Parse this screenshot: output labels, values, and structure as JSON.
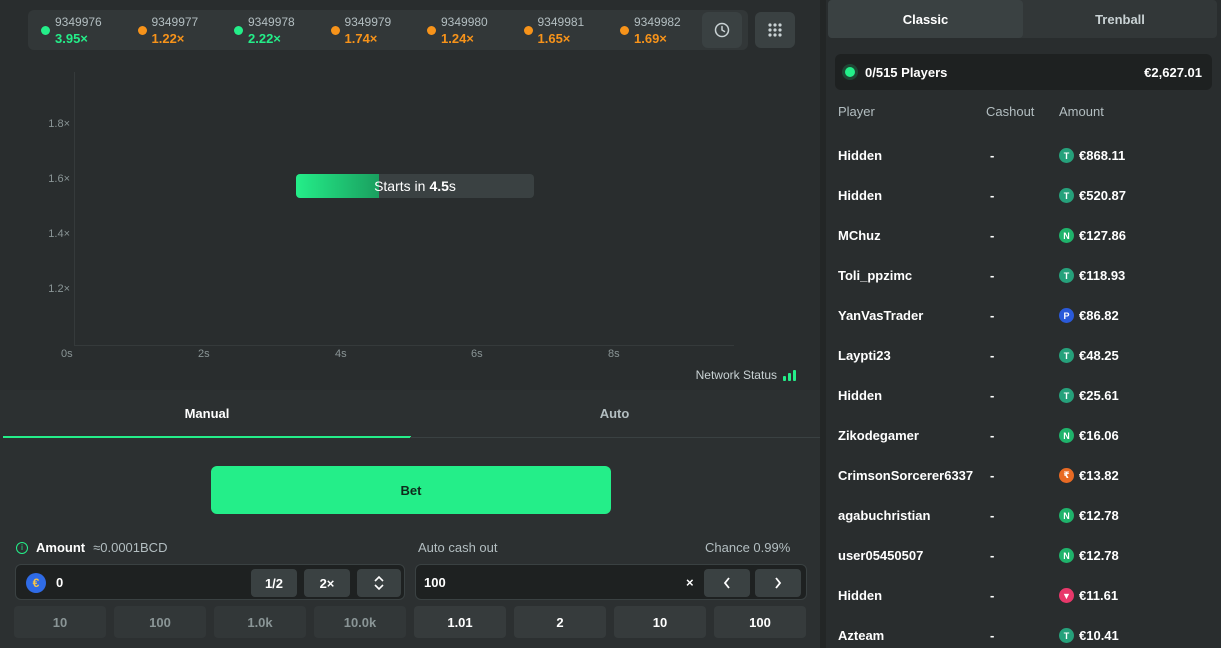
{
  "history": [
    {
      "id": "9349976",
      "mult": "3.95×",
      "color": "#24ee89"
    },
    {
      "id": "9349977",
      "mult": "1.22×",
      "color": "#f7931a"
    },
    {
      "id": "9349978",
      "mult": "2.22×",
      "color": "#24ee89"
    },
    {
      "id": "9349979",
      "mult": "1.74×",
      "color": "#f7931a"
    },
    {
      "id": "9349980",
      "mult": "1.24×",
      "color": "#f7931a"
    },
    {
      "id": "9349981",
      "mult": "1.65×",
      "color": "#f7931a"
    },
    {
      "id": "9349982",
      "mult": "1.69×",
      "color": "#f7931a"
    }
  ],
  "chart": {
    "y_ticks": [
      "1.8×",
      "1.6×",
      "1.4×",
      "1.2×"
    ],
    "x_ticks": [
      "0s",
      "2s",
      "4s",
      "6s",
      "8s"
    ],
    "countdown_prefix": "Starts in",
    "countdown_value": "4.5",
    "countdown_unit": "s",
    "countdown_progress": 0.35,
    "network_label": "Network Status"
  },
  "controls": {
    "tab_manual": "Manual",
    "tab_auto": "Auto",
    "bet_label": "Bet",
    "amount_label": "Amount",
    "amount_approx": "≈0.0001BCD",
    "amount_value": "0",
    "half_label": "1/2",
    "double_label": "2×",
    "auto_cashout_label": "Auto cash out",
    "chance_label": "Chance 0.99%",
    "auto_cashout_value": "100",
    "times_symbol": "×",
    "amount_quick": [
      "10",
      "100",
      "1.0k",
      "10.0k"
    ],
    "cashout_quick": [
      "1.01",
      "2",
      "10",
      "100"
    ]
  },
  "right": {
    "tab_classic": "Classic",
    "tab_trenball": "Trenball",
    "players_count": "0/515 Players",
    "total_amount": "€2,627.01",
    "col_player": "Player",
    "col_cashout": "Cashout",
    "col_amount": "Amount",
    "players": [
      {
        "name": "Hidden",
        "cashout": "-",
        "amount": "€868.11",
        "coin": "T",
        "coin_color": "#26a17b"
      },
      {
        "name": "Hidden",
        "cashout": "-",
        "amount": "€520.87",
        "coin": "T",
        "coin_color": "#26a17b"
      },
      {
        "name": "MChuz",
        "cashout": "-",
        "amount": "€127.86",
        "coin": "N",
        "coin_color": "#1fb36b"
      },
      {
        "name": "Toli_ppzimc",
        "cashout": "-",
        "amount": "€118.93",
        "coin": "T",
        "coin_color": "#26a17b"
      },
      {
        "name": "YanVasTrader",
        "cashout": "-",
        "amount": "€86.82",
        "coin": "P",
        "coin_color": "#2a5ad9"
      },
      {
        "name": "Laypti23",
        "cashout": "-",
        "amount": "€48.25",
        "coin": "T",
        "coin_color": "#26a17b"
      },
      {
        "name": "Hidden",
        "cashout": "-",
        "amount": "€25.61",
        "coin": "T",
        "coin_color": "#26a17b"
      },
      {
        "name": "Zikodegamer",
        "cashout": "-",
        "amount": "€16.06",
        "coin": "N",
        "coin_color": "#1fb36b"
      },
      {
        "name": "CrimsonSorcerer6337",
        "cashout": "-",
        "amount": "€13.82",
        "coin": "₹",
        "coin_color": "#e86a24"
      },
      {
        "name": "agabuchristian",
        "cashout": "-",
        "amount": "€12.78",
        "coin": "N",
        "coin_color": "#1fb36b"
      },
      {
        "name": "user05450507",
        "cashout": "-",
        "amount": "€12.78",
        "coin": "N",
        "coin_color": "#1fb36b"
      },
      {
        "name": "Hidden",
        "cashout": "-",
        "amount": "€11.61",
        "coin": "▼",
        "coin_color": "#e8386a"
      },
      {
        "name": "Azteam",
        "cashout": "-",
        "amount": "€10.41",
        "coin": "T",
        "coin_color": "#26a17b"
      }
    ]
  }
}
